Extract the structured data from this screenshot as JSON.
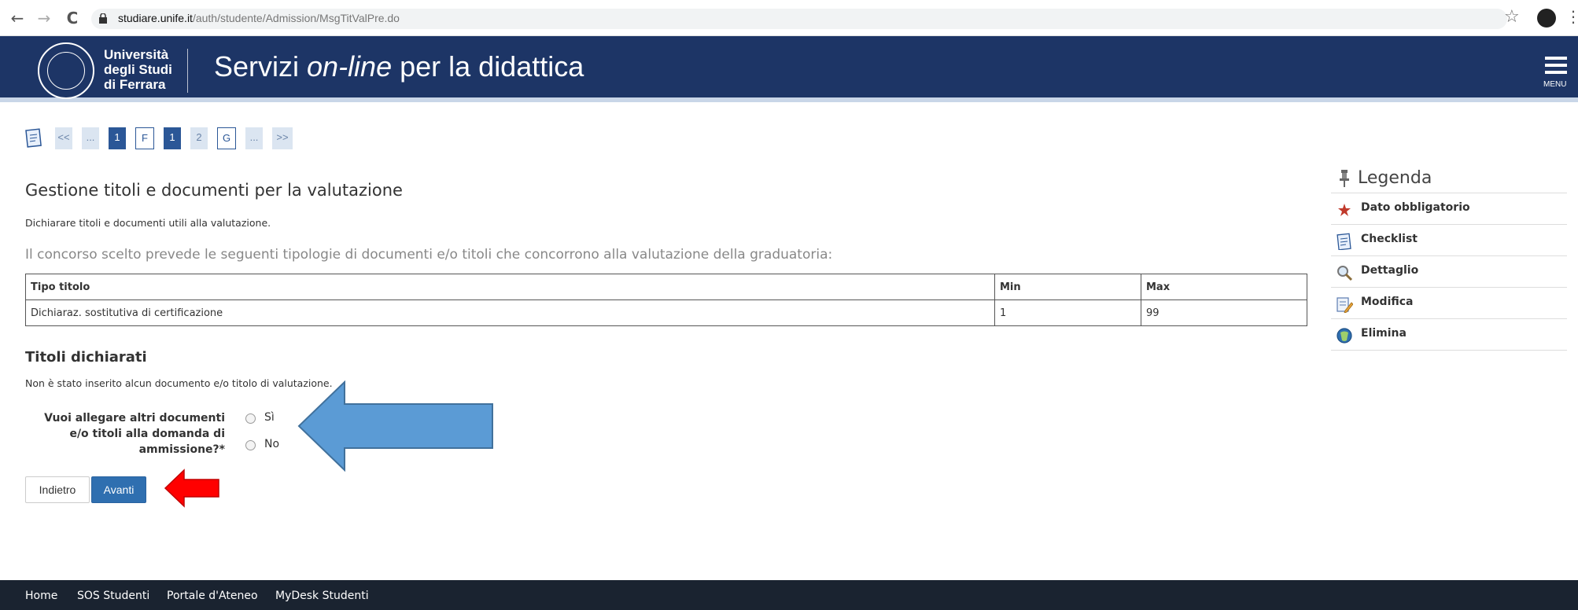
{
  "browser": {
    "back_icon": "←",
    "forward_icon": "→",
    "reload_icon": "C",
    "url_host": "studiare.unife.it",
    "url_path": "/auth/studente/Admission/MsgTitValPre.do",
    "star_icon": "☆",
    "menu_icon": "⋮"
  },
  "header": {
    "university_line1": "Università",
    "university_line2": "degli Studi",
    "university_line3": "di Ferrara",
    "title_before": "Servizi ",
    "title_italic": "on-line",
    "title_after": " per la didattica",
    "menu_label": "MENU",
    "brand_color": "#1d3566"
  },
  "steps": {
    "items": [
      "<<",
      "...",
      "1",
      "F",
      "1",
      "2",
      "G",
      "...",
      ">>"
    ],
    "active_color": "#2b5797"
  },
  "main": {
    "title": "Gestione titoli e documenti per la valutazione",
    "intro": "Dichiarare titoli e documenti utili alla valutazione.",
    "concorso_text": "Il concorso scelto prevede le seguenti tipologie di documenti e/o titoli che concorrono alla valutazione della graduatoria:",
    "table": {
      "headers": [
        "Tipo titolo",
        "Min",
        "Max"
      ],
      "rows": [
        [
          "Dichiaraz. sostitutiva di certificazione",
          "1",
          "99"
        ]
      ]
    },
    "declared_title": "Titoli dichiarati",
    "declared_empty": "Non è stato inserito alcun documento e/o titolo di valutazione.",
    "question_line1": "Vuoi allegare altri documenti",
    "question_line2": "e/o titoli alla domanda di",
    "question_line3": "ammissione?*",
    "option_yes": "Sì",
    "option_no": "No",
    "back_button": "Indietro",
    "next_button": "Avanti"
  },
  "legend": {
    "title": "Legenda",
    "items": [
      {
        "label": "Dato obbligatorio",
        "icon": "required-star-icon"
      },
      {
        "label": "Checklist",
        "icon": "checklist-icon"
      },
      {
        "label": "Dettaglio",
        "icon": "magnifier-icon"
      },
      {
        "label": "Modifica",
        "icon": "edit-icon"
      },
      {
        "label": "Elimina",
        "icon": "delete-icon"
      }
    ]
  },
  "footer": {
    "links": [
      "Home",
      "SOS Studenti",
      "Portale d'Ateneo",
      "MyDesk Studenti"
    ]
  },
  "annotations": {
    "blue_arrow_color": "#5b9bd5",
    "red_arrow_color": "#ff0000"
  }
}
